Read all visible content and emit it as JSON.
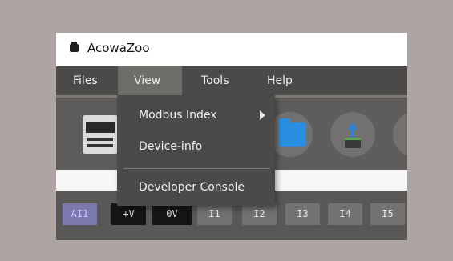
{
  "window": {
    "title": "AcowaZoo"
  },
  "menubar": {
    "items": [
      {
        "label": "Files"
      },
      {
        "label": "View"
      },
      {
        "label": "Tools"
      },
      {
        "label": "Help"
      }
    ]
  },
  "view_menu": {
    "items": [
      {
        "label": "Modbus Index"
      },
      {
        "label": "Device-info"
      },
      {
        "label": "Developer Console"
      }
    ]
  },
  "io_chips": [
    "AI1",
    "+V",
    "0V",
    "I1",
    "I2",
    "I3",
    "I4",
    "I5"
  ],
  "colors": {
    "menu_background": "#4b4a48",
    "menu_active": "#6f6d6a",
    "folder": "#2a8ee0",
    "ai_chip": "#7a78ad"
  }
}
